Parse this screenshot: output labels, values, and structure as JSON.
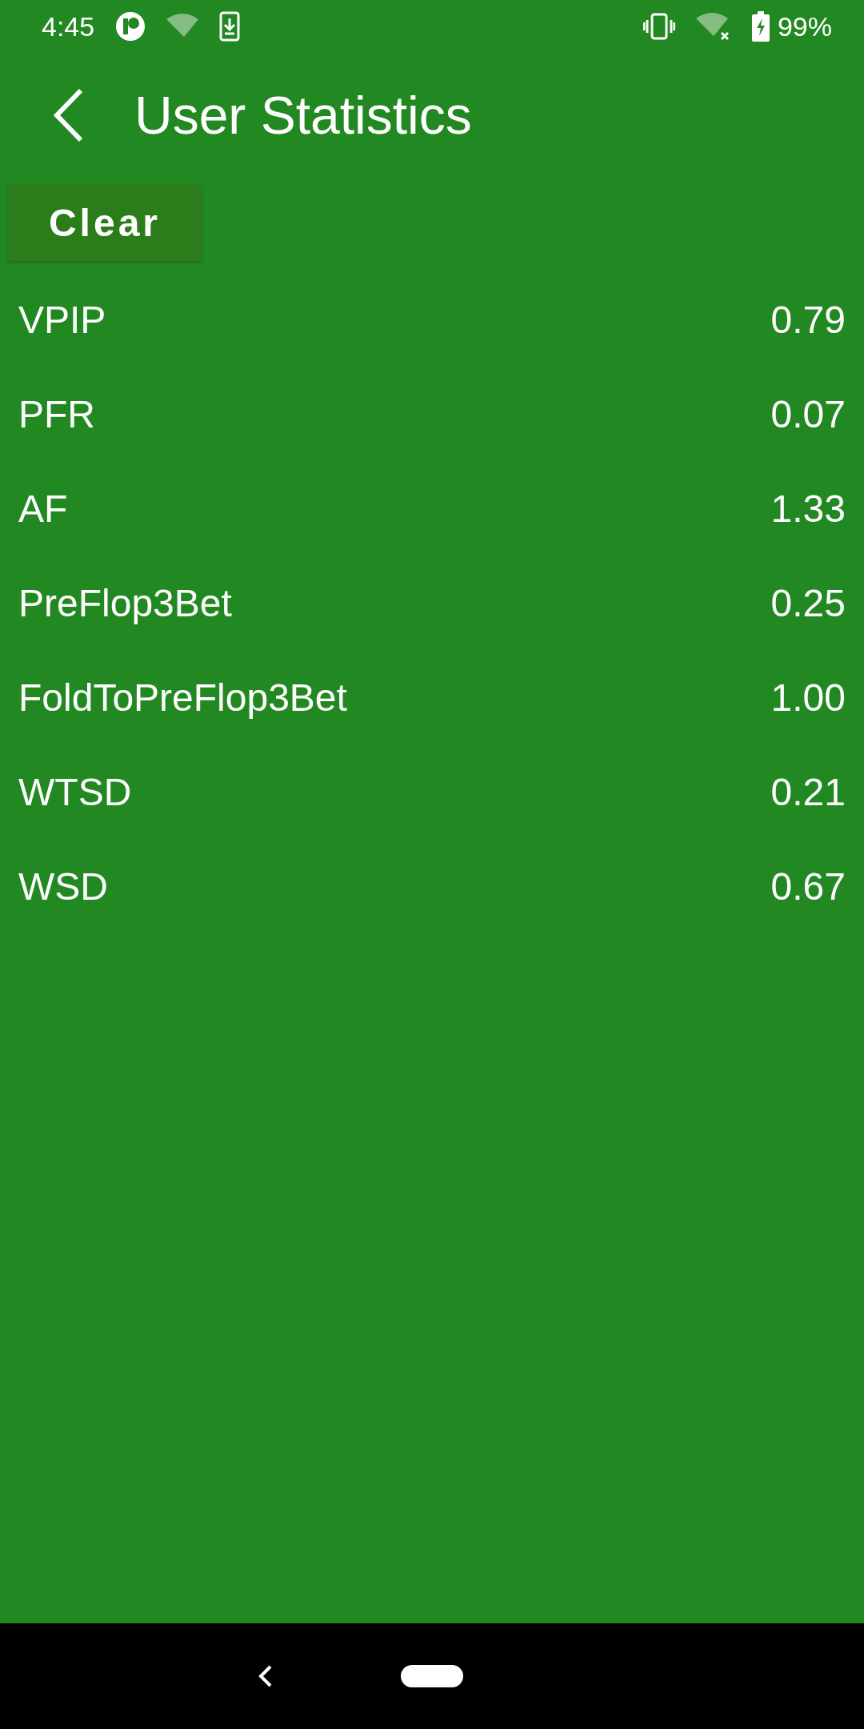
{
  "status_bar": {
    "time": "4:45",
    "battery": "99%"
  },
  "toolbar": {
    "title": "User Statistics"
  },
  "clear_button": {
    "label": "Clear"
  },
  "stats": [
    {
      "name": "VPIP",
      "value": "0.79"
    },
    {
      "name": "PFR",
      "value": "0.07"
    },
    {
      "name": "AF",
      "value": "1.33"
    },
    {
      "name": "PreFlop3Bet",
      "value": "0.25"
    },
    {
      "name": "FoldToPreFlop3Bet",
      "value": "1.00"
    },
    {
      "name": "WTSD",
      "value": "0.21"
    },
    {
      "name": "WSD",
      "value": "0.67"
    }
  ]
}
